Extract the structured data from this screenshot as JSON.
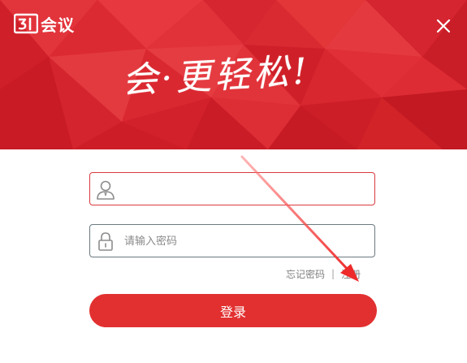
{
  "header": {
    "logo_text": "会议",
    "slogan": "会·更轻松!"
  },
  "form": {
    "username_value": "",
    "password_placeholder": "请输入密码"
  },
  "links": {
    "forgot_password": "忘记密码",
    "separator": "|",
    "register": "注册"
  },
  "login_button": "登录",
  "colors": {
    "brand_red": "#d9232d",
    "button_red": "#e23030",
    "active_border": "#d93a3f",
    "idle_border": "#6b7a80"
  },
  "icons": {
    "close": "close-icon",
    "user": "user-icon",
    "lock": "lock-icon",
    "logo": "logo-mark-icon"
  }
}
